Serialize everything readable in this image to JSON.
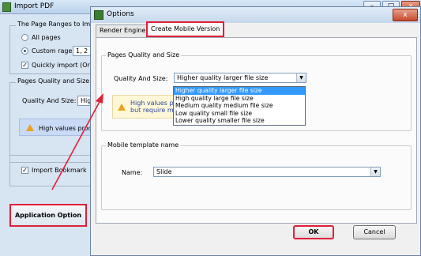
{
  "back_window": {
    "title": "Import PDF",
    "page_ranges_group": "The Page Ranges to Impo",
    "all_pages": "All pages",
    "custom_rage_label": "Custom rage:",
    "custom_rage_value": "1, 2",
    "quickly_import": "Quickly import (Only",
    "pages_quality_group": "Pages Quality and Size",
    "quality_and_size_label": "Quality And Size:",
    "quality_value": "Hig",
    "warning_text": "High values produ",
    "import_bookmark": "Import Bookmark",
    "application_option": "Application Option",
    "ctrl_min": "–",
    "ctrl_max": "□",
    "ctrl_close": "x"
  },
  "dialog": {
    "title": "Options",
    "close": "x",
    "tabs": [
      "Render Engine",
      "Create Mobile Version"
    ],
    "active_tab": 1,
    "pages_quality_group": "Pages Quality and Size",
    "quality_and_size_label": "Quality And Size:",
    "quality_selected": "Higher quality larger file size",
    "quality_options": [
      "Higher quality larger file size",
      "High quality large file size",
      "Medium quality medium file size",
      "Low quality small file size",
      "Lower quality smaller file size"
    ],
    "info_line1": "High values p",
    "info_line2": "but require m",
    "mobile_template_group": "Mobile template name",
    "name_label": "Name:",
    "name_value": "Slide",
    "ok": "OK",
    "cancel": "Cancel"
  },
  "colors": {
    "highlight_border": "#e0203a",
    "selection": "#3399ff",
    "warning": "#e9a320"
  },
  "icons": [
    "app-icon",
    "options-icon",
    "warning-icon",
    "chevron-down-icon",
    "close-icon",
    "annotation-arrow"
  ]
}
